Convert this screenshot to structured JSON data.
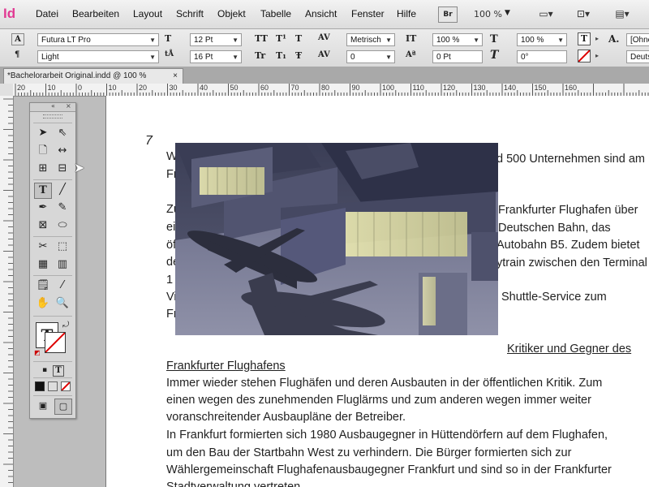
{
  "app": {
    "logo": "Id"
  },
  "menu": [
    "Datei",
    "Bearbeiten",
    "Layout",
    "Schrift",
    "Objekt",
    "Tabelle",
    "Ansicht",
    "Fenster",
    "Hilfe"
  ],
  "toolbar": {
    "bridge_label": "Br",
    "zoom": "100 %"
  },
  "control": {
    "font_family": "Futura LT Pro",
    "font_style": "Light",
    "font_size": "12 Pt",
    "leading": "16 Pt",
    "kerning": "Metrisch",
    "tracking": "0",
    "vscale": "100 %",
    "baseline": "0 Pt",
    "hscale": "100 %",
    "skew": "0°",
    "style_field_1": "[Ohne",
    "style_field_2": "Deuts"
  },
  "tab": {
    "title": "*Bachelorarbeit Original.indd @ 100 %",
    "close": "×"
  },
  "ruler": {
    "h_labels": [
      "20",
      "10",
      "0",
      "10",
      "20",
      "30",
      "40",
      "50",
      "60",
      "70",
      "80",
      "90",
      "100",
      "110",
      "120",
      "130",
      "140",
      "150",
      "160"
    ]
  },
  "page": {
    "number": "7",
    "left_fragments": [
      "W",
      "Fr",
      "Zu",
      "ei",
      "öf",
      "de",
      "1",
      "Vi",
      "Fr"
    ],
    "right_fragments": [
      "d 500 Unternehmen sind am",
      "Frankfurter Flughafen über",
      "Deutschen Bahn, das",
      "Autobahn B5. Zudem bietet",
      "ytrain zwischen den Terminal",
      "Shuttle-Service zum"
    ],
    "heading_right": "Kritiker und Gegner des ",
    "heading_left": "Frankfurter Flughafens",
    "body_lines": [
      "Immer wieder stehen Flughäfen und deren Ausbauten in der öffentlichen Kritik. Zum",
      "einen wegen des zunehmenden Fluglärms und zum anderen wegen immer weiter",
      "voranschreitender Ausbaupläne der Betreiber.",
      "In Frankfurt formierten sich 1980 Ausbaugegner in Hüttendörfern auf dem Flughafen,",
      "um den Bau der Startbahn West zu verhindern. Die Bürger formierten sich zur",
      "Wählergemeinschaft Flughafenausbaugegner Frankfurt und sind so in der Frankfurter",
      "Stadtverwaltung vertreten."
    ]
  },
  "colors": {
    "accent": "#e13b93",
    "ruler": "#f2f2f2",
    "pasteboard": "#bdbdbd"
  }
}
